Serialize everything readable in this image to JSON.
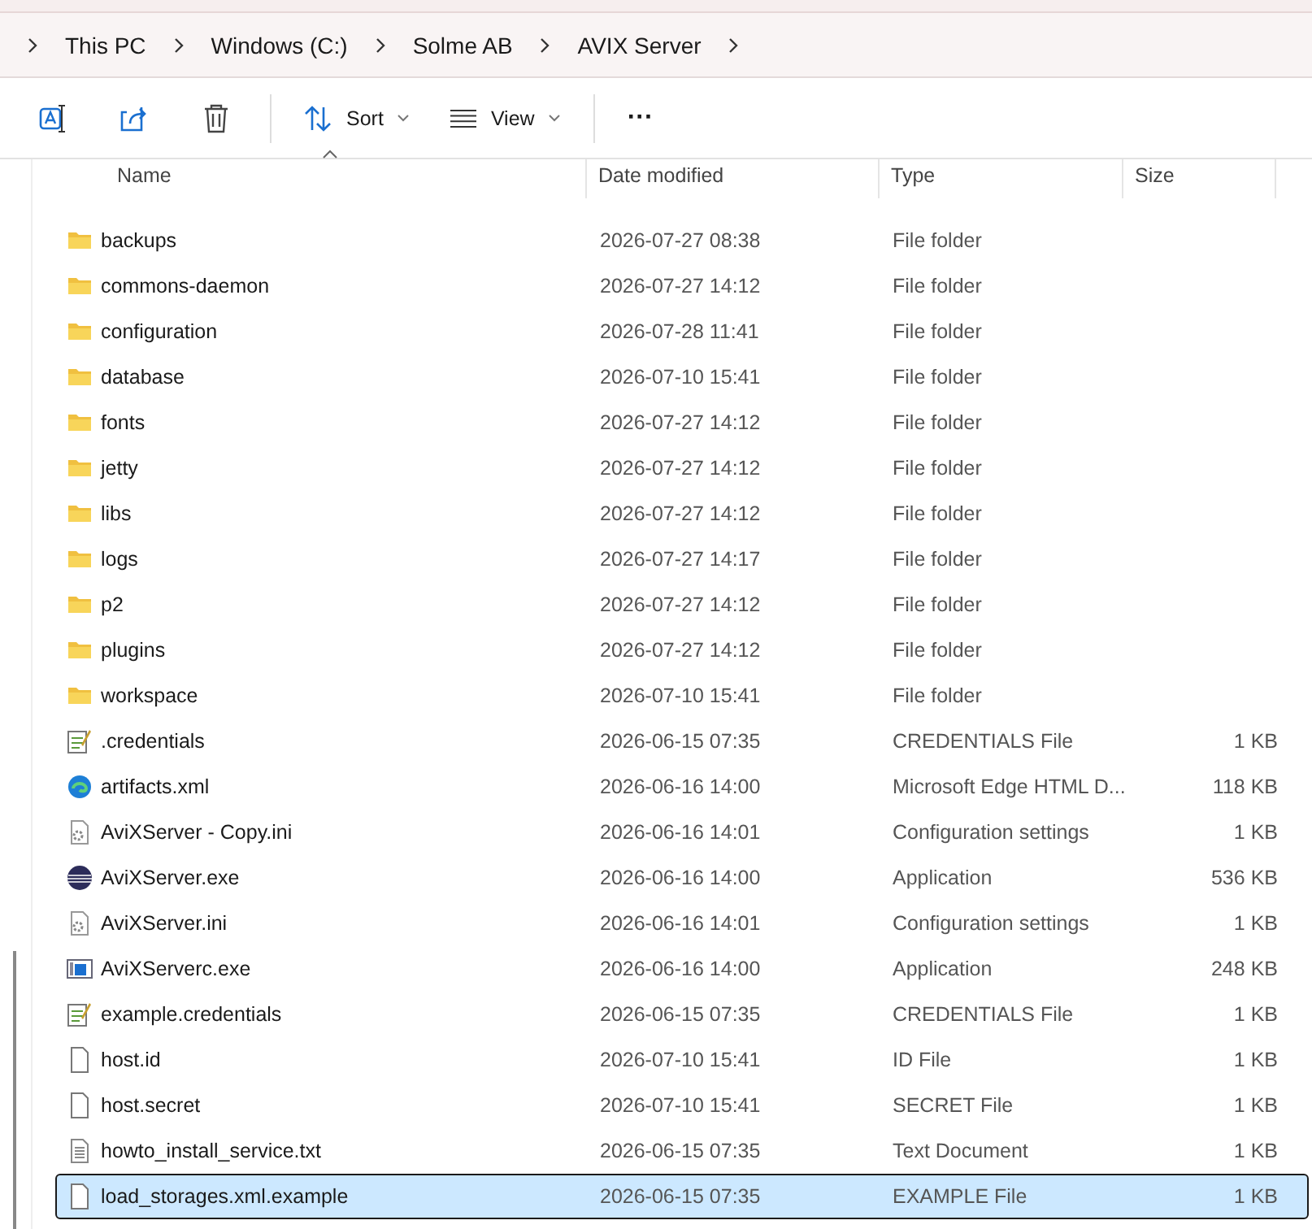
{
  "breadcrumb": [
    "This PC",
    "Windows (C:)",
    "Solme AB",
    "AVIX Server"
  ],
  "toolbar": {
    "sort": "Sort",
    "view": "View",
    "more": "···"
  },
  "columns": [
    "Name",
    "Date modified",
    "Type",
    "Size"
  ],
  "rows": [
    {
      "kind": "folder",
      "name": "backups",
      "date": "2026-07-27 08:38",
      "type": "File folder",
      "size": "",
      "selected": false
    },
    {
      "kind": "folder",
      "name": "commons-daemon",
      "date": "2026-07-27 14:12",
      "type": "File folder",
      "size": "",
      "selected": false
    },
    {
      "kind": "folder",
      "name": "configuration",
      "date": "2026-07-28 11:41",
      "type": "File folder",
      "size": "",
      "selected": false
    },
    {
      "kind": "folder",
      "name": "database",
      "date": "2026-07-10 15:41",
      "type": "File folder",
      "size": "",
      "selected": false
    },
    {
      "kind": "folder",
      "name": "fonts",
      "date": "2026-07-27 14:12",
      "type": "File folder",
      "size": "",
      "selected": false
    },
    {
      "kind": "folder",
      "name": "jetty",
      "date": "2026-07-27 14:12",
      "type": "File folder",
      "size": "",
      "selected": false
    },
    {
      "kind": "folder",
      "name": "libs",
      "date": "2026-07-27 14:12",
      "type": "File folder",
      "size": "",
      "selected": false
    },
    {
      "kind": "folder",
      "name": "logs",
      "date": "2026-07-27 14:17",
      "type": "File folder",
      "size": "",
      "selected": false
    },
    {
      "kind": "folder",
      "name": "p2",
      "date": "2026-07-27 14:12",
      "type": "File folder",
      "size": "",
      "selected": false
    },
    {
      "kind": "folder",
      "name": "plugins",
      "date": "2026-07-27 14:12",
      "type": "File folder",
      "size": "",
      "selected": false
    },
    {
      "kind": "folder",
      "name": "workspace",
      "date": "2026-07-10 15:41",
      "type": "File folder",
      "size": "",
      "selected": false
    },
    {
      "kind": "notes",
      "name": ".credentials",
      "date": "2026-06-15 07:35",
      "type": "CREDENTIALS File",
      "size": "1 KB",
      "selected": false
    },
    {
      "kind": "web",
      "name": "artifacts.xml",
      "date": "2026-06-16 14:00",
      "type": "Microsoft Edge HTML D...",
      "size": "118 KB",
      "selected": false
    },
    {
      "kind": "settings",
      "name": "AviXServer - Copy.ini",
      "date": "2026-06-16 14:01",
      "type": "Configuration settings",
      "size": "1 KB",
      "selected": false
    },
    {
      "kind": "globe",
      "name": "AviXServer.exe",
      "date": "2026-06-16 14:00",
      "type": "Application",
      "size": "536 KB",
      "selected": false
    },
    {
      "kind": "settings",
      "name": "AviXServer.ini",
      "date": "2026-06-16 14:01",
      "type": "Configuration settings",
      "size": "1 KB",
      "selected": false
    },
    {
      "kind": "app",
      "name": "AviXServerc.exe",
      "date": "2026-06-16 14:00",
      "type": "Application",
      "size": "248 KB",
      "selected": false
    },
    {
      "kind": "notes",
      "name": "example.credentials",
      "date": "2026-06-15 07:35",
      "type": "CREDENTIALS File",
      "size": "1 KB",
      "selected": false
    },
    {
      "kind": "blank",
      "name": "host.id",
      "date": "2026-07-10 15:41",
      "type": "ID File",
      "size": "1 KB",
      "selected": false
    },
    {
      "kind": "blank",
      "name": "host.secret",
      "date": "2026-07-10 15:41",
      "type": "SECRET File",
      "size": "1 KB",
      "selected": false
    },
    {
      "kind": "text",
      "name": "howto_install_service.txt",
      "date": "2026-06-15 07:35",
      "type": "Text Document",
      "size": "1 KB",
      "selected": false
    },
    {
      "kind": "blank",
      "name": "load_storages.xml.example",
      "date": "2026-06-15 07:35",
      "type": "EXAMPLE File",
      "size": "1 KB",
      "selected": true
    }
  ]
}
